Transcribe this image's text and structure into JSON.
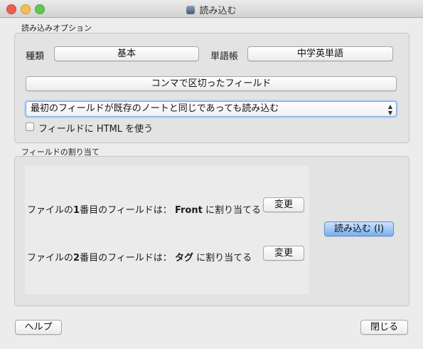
{
  "window": {
    "title": "読み込む",
    "app_icon": "anki-icon"
  },
  "options": {
    "group_label": "読み込みオプション",
    "type_label": "種類",
    "type_value": "基本",
    "deck_label": "単語帳",
    "deck_value": "中学英単語",
    "separator_button": "コンマで区切ったフィールド",
    "update_mode": "最初のフィールドが既存のノートと同じであっても読み込む",
    "html_checkbox_label": "フィールドに HTML を使う",
    "html_checked": false
  },
  "mapping": {
    "group_label": "フィールドの割り当て",
    "rows": [
      {
        "prefix": "ファイルの",
        "num": "1",
        "middle": "番目のフィールドは：",
        "target": "Front",
        "suffix": "に割り当てる",
        "change_label": "変更"
      },
      {
        "prefix": "ファイルの",
        "num": "2",
        "middle": "番目のフィールドは：",
        "target": "タグ",
        "suffix": "に割り当てる",
        "change_label": "変更"
      }
    ],
    "import_button": "読み込む (I)"
  },
  "footer": {
    "help_button": "ヘルプ",
    "close_button": "閉じる"
  },
  "colors": {
    "default_button": "#79aef2",
    "focus_ring": "#b7d1f3"
  }
}
